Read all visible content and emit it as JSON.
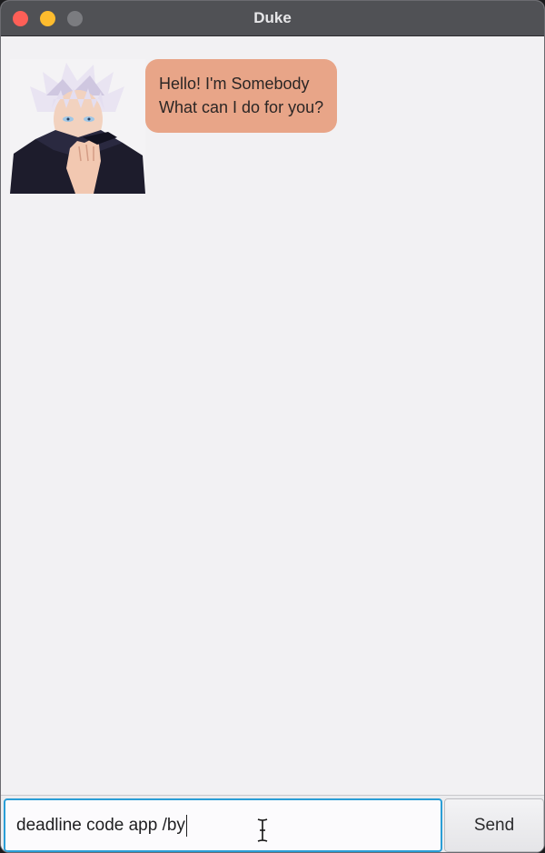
{
  "window": {
    "title": "Duke"
  },
  "chat": {
    "messages": [
      {
        "sender": "bot",
        "avatar_icon": "anime-character-avatar",
        "lines": [
          "Hello! I'm Somebody",
          "What can I do for you?"
        ]
      }
    ]
  },
  "input": {
    "value": "deadline code app /by",
    "send_label": "Send"
  },
  "colors": {
    "titlebar": "#505155",
    "background": "#f2f1f3",
    "bot_bubble": "#e8a588",
    "input_focus": "#2a9ed6",
    "close": "#fe5f57",
    "minimize": "#febc2e"
  }
}
